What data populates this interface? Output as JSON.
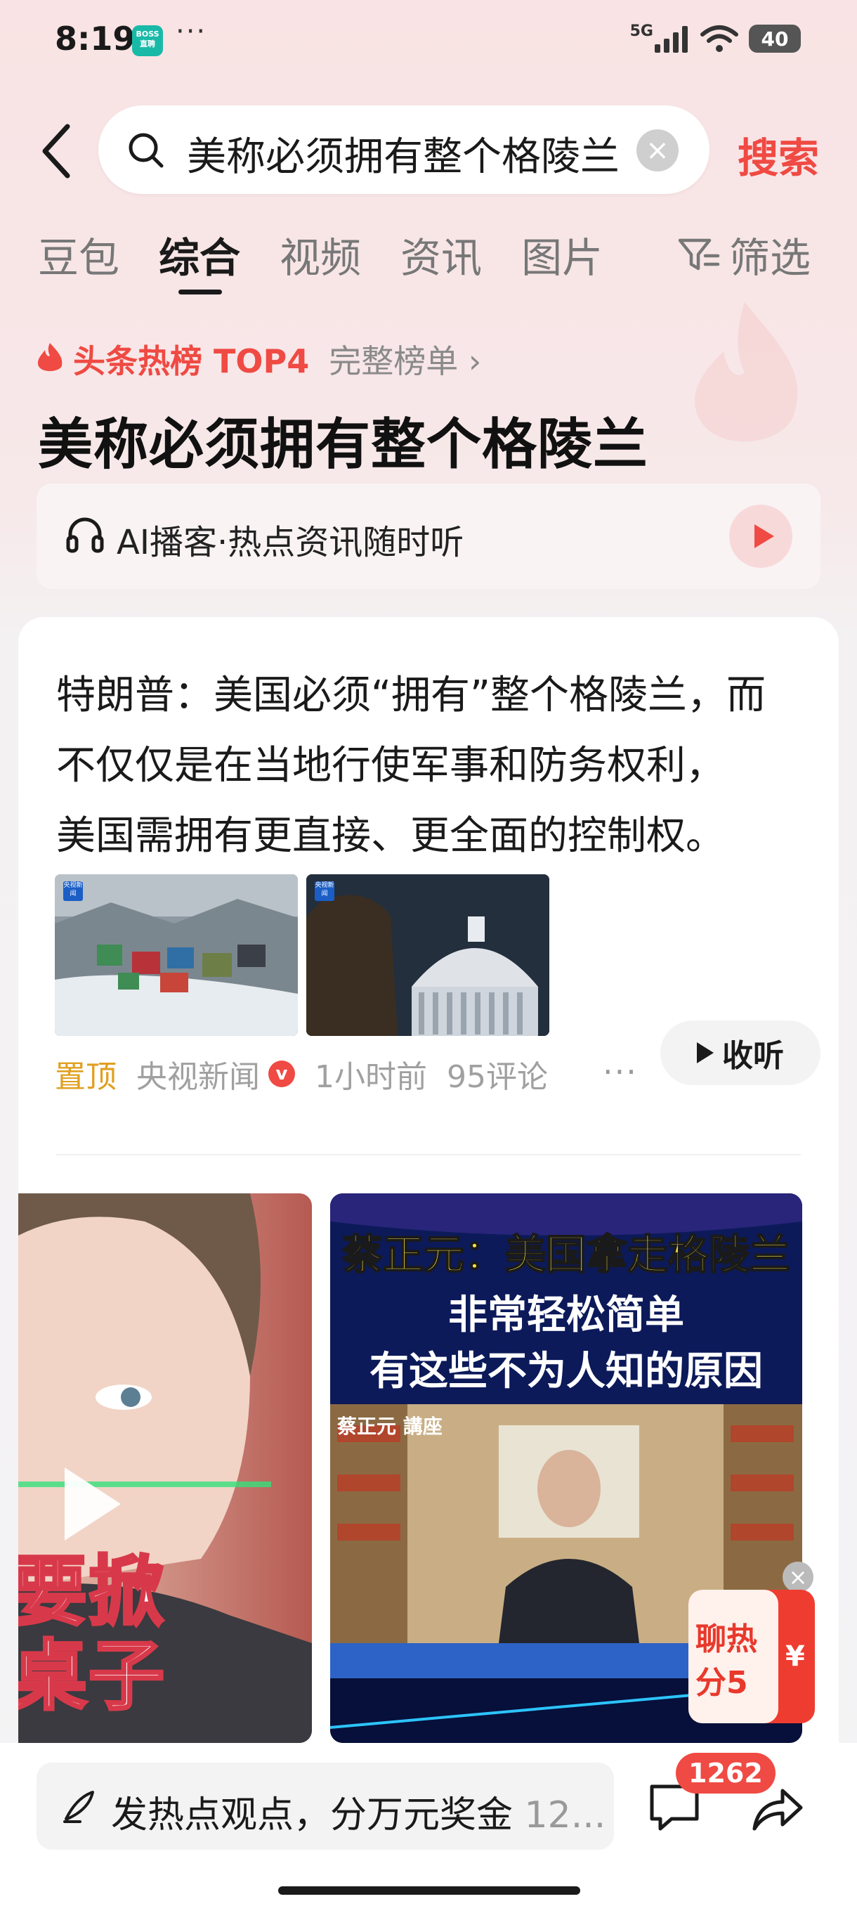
{
  "status": {
    "time": "8:19",
    "boss_badge": "BOSS直聘",
    "more": "···",
    "network": "5G",
    "battery": "40"
  },
  "search": {
    "query": "美称必须拥有整个格陵兰",
    "button": "搜索"
  },
  "tabs": [
    {
      "label": "豆包"
    },
    {
      "label": "综合"
    },
    {
      "label": "视频"
    },
    {
      "label": "资讯"
    },
    {
      "label": "图片"
    }
  ],
  "filter_label": "筛选",
  "hot": {
    "label": "头条热榜 TOP4",
    "full_list": "完整榜单 ›"
  },
  "title": "美称必须拥有整个格陵兰",
  "podcast": {
    "text": "AI播客·热点资讯随时听"
  },
  "article": {
    "line1": "特朗普：美国必须“拥有”整个格陵兰，而",
    "line2": "不仅仅是在当地行使军事和防务权利，",
    "line3": "美国需拥有更直接、更全面的控制权。",
    "thumb_badge": "央视新闻",
    "pin": "置顶",
    "source": "央视新闻",
    "verified": "v",
    "time": "1小时前",
    "comments": "95评论",
    "more": "···",
    "listen": "收听"
  },
  "video_left": {
    "line1": "要掀",
    "line2": "桌子"
  },
  "video_right": {
    "headline": "蔡正元：美国拿走格陵兰",
    "sub1": "非常轻松简单",
    "sub2": "有这些不为人知的原因",
    "lecture": "蔡正元 講座"
  },
  "redpacket": {
    "line1": "聊热",
    "line2": "分5",
    "yen": "¥",
    "close": "×"
  },
  "bottom": {
    "placeholder": "发热点观点，分万元奖金",
    "placeholder_tail": "12...",
    "comment_count": "1262"
  },
  "colors": {
    "accent_red": "#ef4a43",
    "pin_orange": "#e0a020",
    "background_pink": "#f9e3e4"
  }
}
